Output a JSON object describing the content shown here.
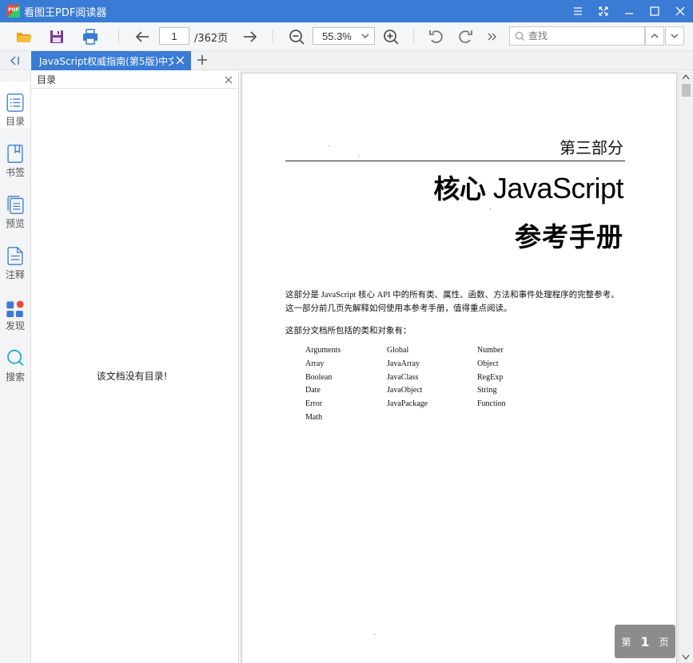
{
  "app": {
    "title": "看图王PDF阅读器",
    "accent": "#3a7bd5"
  },
  "toolbar": {
    "page_value": "1",
    "page_total": "/362页",
    "zoom": "55.3%",
    "search_placeholder": "查找"
  },
  "tabs": [
    {
      "title": "JavaScript权威指南(第5版)中文"
    }
  ],
  "sidebar": {
    "items": [
      {
        "label": "目录",
        "icon": "list-icon"
      },
      {
        "label": "书签",
        "icon": "bookmark-icon"
      },
      {
        "label": "预览",
        "icon": "thumbnails-icon"
      },
      {
        "label": "注释",
        "icon": "annotation-icon"
      },
      {
        "label": "发现",
        "icon": "discover-icon"
      },
      {
        "label": "搜索",
        "icon": "search-icon"
      }
    ]
  },
  "panel": {
    "title": "目录",
    "empty_message": "该文档没有目录!"
  },
  "document": {
    "part": "第三部分",
    "title_cn": "核心",
    "title_en": "JavaScript",
    "subtitle": "参考手册",
    "intro": "这部分是 JavaScript 核心 API 中的所有类、属性、函数、方法和事件处理程序的完整参考。这一部分前几页先解释如何使用本参考手册，值得重点阅读。",
    "list_intro": "这部分文档所包括的类和对象有：",
    "columns": [
      [
        "Arguments",
        "Array",
        "Boolean",
        "Date",
        "Error",
        "Math"
      ],
      [
        "Global",
        "JavaArray",
        "JavaClass",
        "JavaObject",
        "JavaPackage"
      ],
      [
        "Number",
        "Object",
        "RegExp",
        "String",
        "Function"
      ]
    ]
  },
  "page_indicator": {
    "prefix": "第",
    "number": "1",
    "suffix": "页"
  }
}
